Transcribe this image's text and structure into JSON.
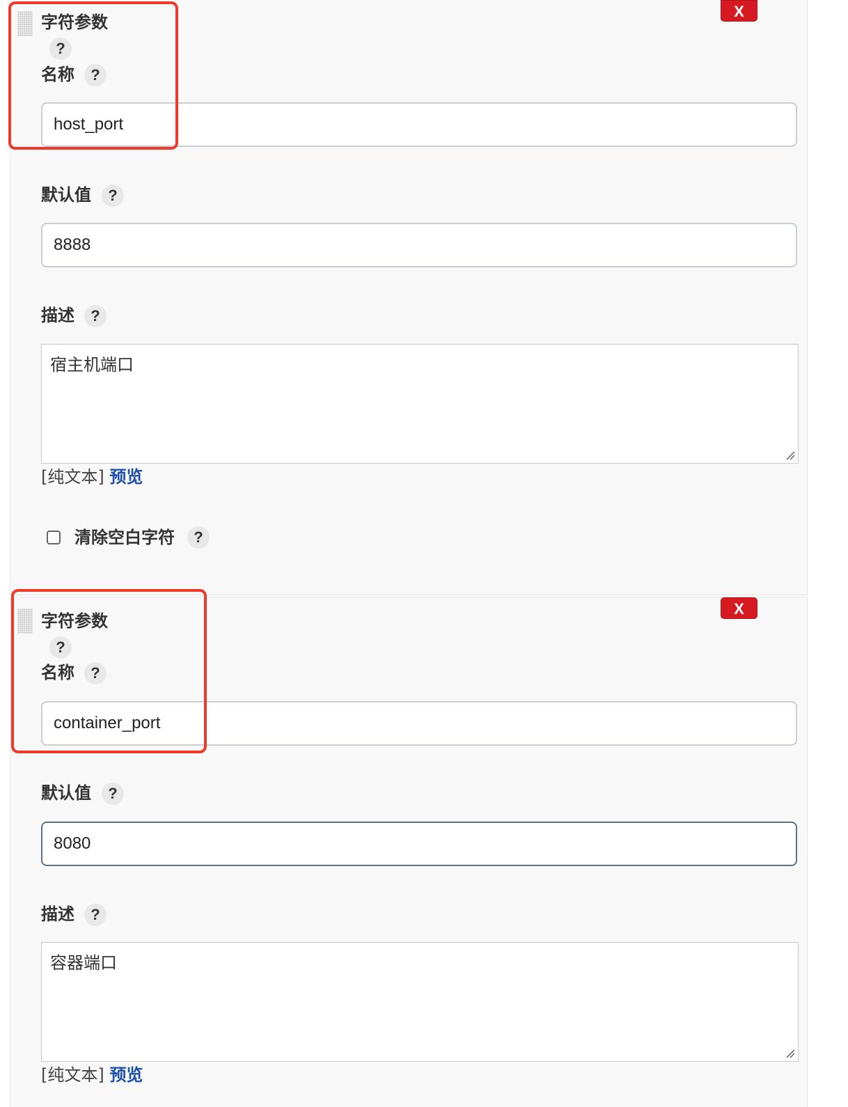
{
  "colors": {
    "delete_button": "#d71921",
    "highlight": "#ee3a2a",
    "preview_link": "#1f4fa8",
    "focused_border": "#5e7282"
  },
  "params": [
    {
      "title": "字符参数",
      "delete_label": "X",
      "help_label": "?",
      "name_label": "名称",
      "name_value": "host_port",
      "default_label": "默认值",
      "default_value": "8888",
      "desc_label": "描述",
      "desc_value": "宿主机端口",
      "format_label": "[纯文本]",
      "preview_label": "预览",
      "trim_label": "清除空白字符"
    },
    {
      "title": "字符参数",
      "delete_label": "X",
      "help_label": "?",
      "name_label": "名称",
      "name_value": "container_port",
      "default_label": "默认值",
      "default_value": "8080",
      "desc_label": "描述",
      "desc_value": "容器端口",
      "format_label": "[纯文本]",
      "preview_label": "预览"
    }
  ]
}
